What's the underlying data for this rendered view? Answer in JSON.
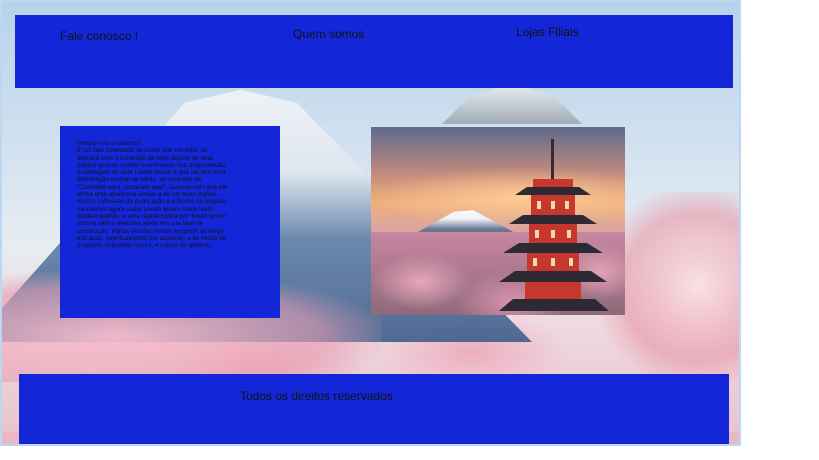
{
  "nav": {
    "links": [
      {
        "label": "Fale conosco !"
      },
      {
        "label": "Quem somos"
      },
      {
        "label": "Lojas Filiais"
      }
    ]
  },
  "content": {
    "heading": "Porque nós o usamos?",
    "paragraph": "É um fato conhecido de todos que um leitor se distrairá com o conteúdo de texto legível de uma página quando estiver examinando sua diagramação. A vantagem de usar Lorem Ipsum é que ele tem uma distribuição normal de letras, ao contrário de \"Conteúdo aqui, conteúdo aqui\", fazendo com que ele tenha uma aparência similar a de um texto legível. Muitos softwares de publicação e editores de páginas na internet agora usam Lorem Ipsum como texto-modelo padrão, e uma rápida busca por 'lorem ipsum' mostra vários websites ainda em sua fase de construção. Várias versões novas surgiram ao longo dos anos, eventualmente por acidente, e às vezes de propósito (injetando humor, e coisas do gênero)."
  },
  "footer": {
    "text": "Todos os direitos reservados"
  },
  "colors": {
    "panel_blue": "#1427d8"
  }
}
